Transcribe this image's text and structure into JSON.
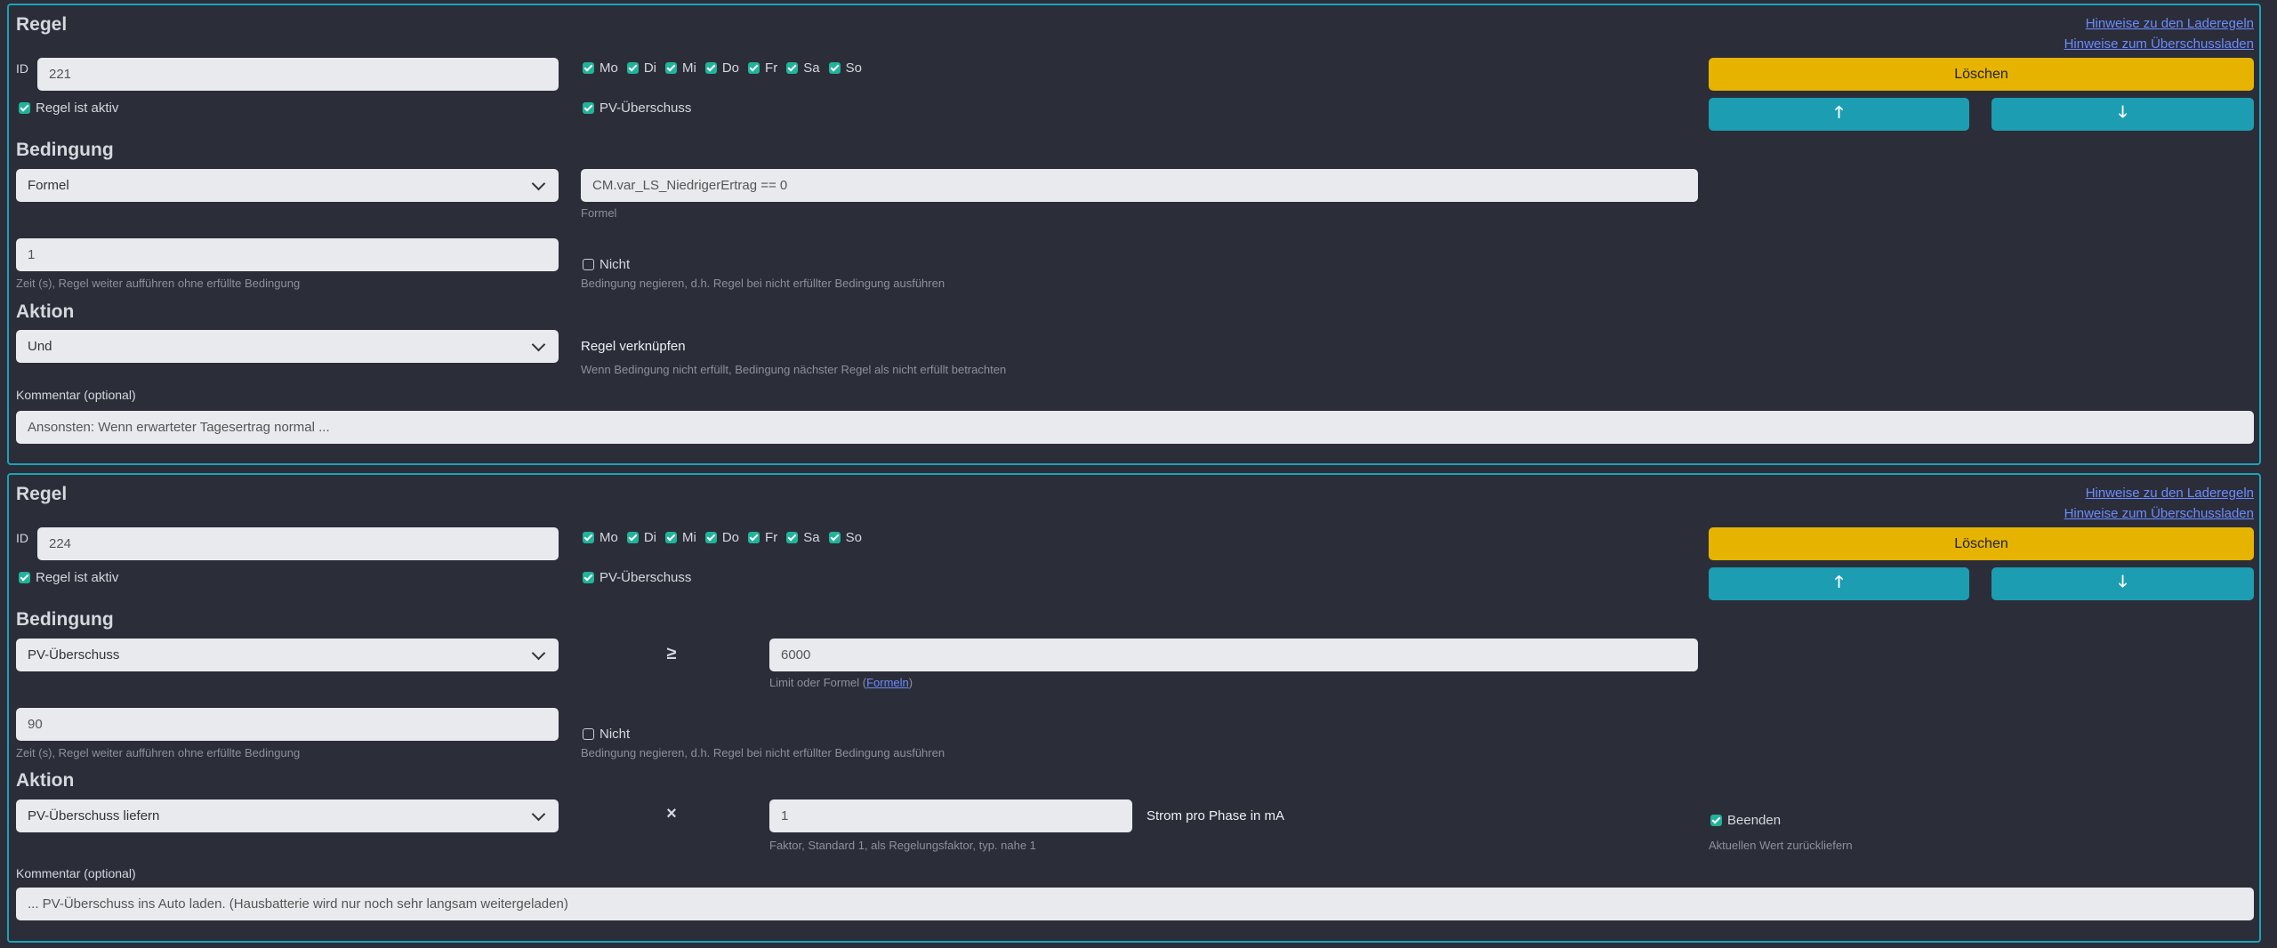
{
  "rules": [
    {
      "title": "Regel",
      "links": [
        "Hinweise zu den Laderegeln",
        "Hinweise zum Überschussladen"
      ],
      "id_label": "ID",
      "id_value": "221",
      "days": [
        {
          "label": "Mo",
          "checked": true
        },
        {
          "label": "Di",
          "checked": true
        },
        {
          "label": "Mi",
          "checked": true
        },
        {
          "label": "Do",
          "checked": true
        },
        {
          "label": "Fr",
          "checked": true
        },
        {
          "label": "Sa",
          "checked": true
        },
        {
          "label": "So",
          "checked": true
        }
      ],
      "active_label": "Regel ist aktiv",
      "pv_label": "PV-Überschuss",
      "delete_label": "Löschen",
      "up_icon": "arrow-up-icon",
      "down_icon": "arrow-down-icon",
      "condition_heading": "Bedingung",
      "condition_select": "Formel",
      "formula_value": "CM.var_LS_NiedrigerErtrag == 0",
      "formula_help": "Formel",
      "time_value": "1",
      "time_help": "Zeit (s), Regel weiter aufführen ohne erfüllte Bedingung",
      "not_label": "Nicht",
      "not_help": "Bedingung negieren, d.h. Regel bei nicht erfüllter Bedingung ausführen",
      "action_heading": "Aktion",
      "action_select": "Und",
      "link_rule_label": "Regel verknüpfen",
      "link_rule_help": "Wenn Bedingung nicht erfüllt, Bedingung nächster Regel als nicht erfüllt betrachten",
      "comment_label": "Kommentar (optional)",
      "comment_value": "Ansonsten: Wenn erwarteter Tagesertrag normal ..."
    },
    {
      "title": "Regel",
      "links": [
        "Hinweise zu den Laderegeln",
        "Hinweise zum Überschussladen"
      ],
      "id_label": "ID",
      "id_value": "224",
      "days": [
        {
          "label": "Mo",
          "checked": true
        },
        {
          "label": "Di",
          "checked": true
        },
        {
          "label": "Mi",
          "checked": true
        },
        {
          "label": "Do",
          "checked": true
        },
        {
          "label": "Fr",
          "checked": true
        },
        {
          "label": "Sa",
          "checked": true
        },
        {
          "label": "So",
          "checked": true
        }
      ],
      "active_label": "Regel ist aktiv",
      "pv_label": "PV-Überschuss",
      "delete_label": "Löschen",
      "up_icon": "arrow-up-icon",
      "down_icon": "arrow-down-icon",
      "condition_heading": "Bedingung",
      "condition_select": "PV-Überschuss",
      "operator": "≥",
      "limit_value": "6000",
      "limit_help_prefix": "Limit oder Formel (",
      "limit_help_link": "Formeln",
      "limit_help_suffix": ")",
      "time_value": "90",
      "time_help": "Zeit (s), Regel weiter aufführen ohne erfüllte Bedingung",
      "not_label": "Nicht",
      "not_help": "Bedingung negieren, d.h. Regel bei nicht erfüllter Bedingung ausführen",
      "action_heading": "Aktion",
      "action_select": "PV-Überschuss liefern",
      "action_operator": "×",
      "factor_value": "1",
      "factor_help": "Faktor, Standard 1, als Regelungsfaktor, typ. nahe 1",
      "unit_label": "Strom pro Phase in mA",
      "end_label": "Beenden",
      "end_help": "Aktuellen Wert zurückliefern",
      "comment_label": "Kommentar (optional)",
      "comment_value": "... PV-Überschuss ins Auto laden. (Hausbatterie wird nur noch sehr langsam weitergeladen)"
    }
  ]
}
